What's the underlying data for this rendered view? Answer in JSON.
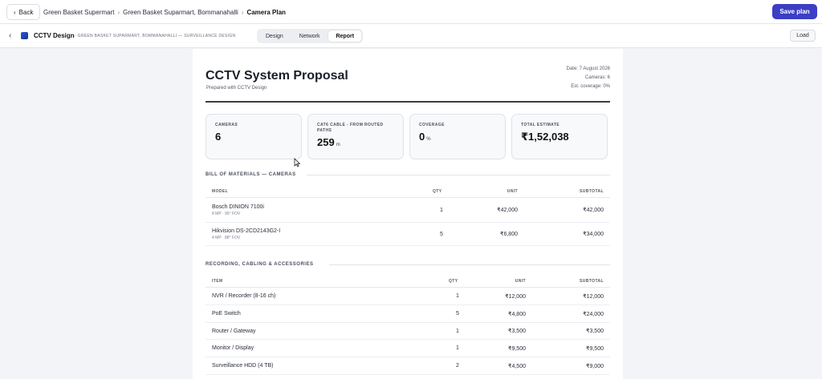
{
  "topbar": {
    "back_label": "Back",
    "breadcrumbs": [
      "Green Basket Supermart",
      "Green Basket Suparmart, Bommanahalli",
      "Camera Plan"
    ],
    "save_label": "Save plan"
  },
  "subbar": {
    "app_title": "CCTV Design",
    "app_subtitle": "· GREEN BASKET SUPARMART, BOMMANAHALLI — SURVEILLANCE DESIGN",
    "tabs": [
      "Design",
      "Network",
      "Report"
    ],
    "active_tab": "Report",
    "load_label": "Load"
  },
  "report": {
    "title": "CCTV System Proposal",
    "prepared": "Prepared with CCTV Design",
    "date": "Date: 7 August 2026",
    "cameras_meta": "Cameras: 6",
    "coverage_meta": "Est. coverage: 0%",
    "cards": [
      {
        "label": "CAMERAS",
        "value": "6",
        "unit": ""
      },
      {
        "label": "CAT6 CABLE - FROM ROUTED PATHS",
        "value": "259",
        "unit": "m"
      },
      {
        "label": "COVERAGE",
        "value": "0",
        "unit": "%"
      },
      {
        "label": "TOTAL ESTIMATE",
        "value": "₹1,52,038",
        "unit": ""
      }
    ],
    "bom_cameras": {
      "title": "BILL OF MATERIALS — CAMERAS",
      "headers": [
        "MODEL",
        "QTY",
        "UNIT",
        "SUBTOTAL"
      ],
      "rows": [
        {
          "name": "Bosch DINION 7100i",
          "spec": "8 MP · 90° FOV",
          "qty": "1",
          "unit": "₹42,000",
          "subtotal": "₹42,000"
        },
        {
          "name": "Hikvision DS-2CD2143G2-I",
          "spec": "4 MP · 88° FOV",
          "qty": "5",
          "unit": "₹6,800",
          "subtotal": "₹34,000"
        }
      ]
    },
    "accessories": {
      "title": "RECORDING, CABLING & ACCESSORIES",
      "headers": [
        "ITEM",
        "QTY",
        "UNIT",
        "SUBTOTAL"
      ],
      "rows": [
        {
          "name": "NVR / Recorder (8-16 ch)",
          "qty": "1",
          "unit": "₹12,000",
          "subtotal": "₹12,000"
        },
        {
          "name": "PoE Switch",
          "qty": "5",
          "unit": "₹4,800",
          "subtotal": "₹24,000"
        },
        {
          "name": "Router / Gateway",
          "qty": "1",
          "unit": "₹3,500",
          "subtotal": "₹3,500"
        },
        {
          "name": "Monitor / Display",
          "qty": "1",
          "unit": "₹9,500",
          "subtotal": "₹9,500"
        },
        {
          "name": "Surveillance HDD (4 TB)",
          "qty": "2",
          "unit": "₹4,500",
          "subtotal": "₹9,000"
        }
      ]
    }
  },
  "icons": {
    "back": "chevron-left-icon",
    "collapse": "chevron-left-icon",
    "app": "camera-app-icon",
    "cursor": "mouse-pointer-icon"
  },
  "colors": {
    "accent": "#3c3ec4",
    "page_bg": "#f3f4f7",
    "card_bg": "#f8f9fb",
    "rule": "#3a3d48"
  }
}
